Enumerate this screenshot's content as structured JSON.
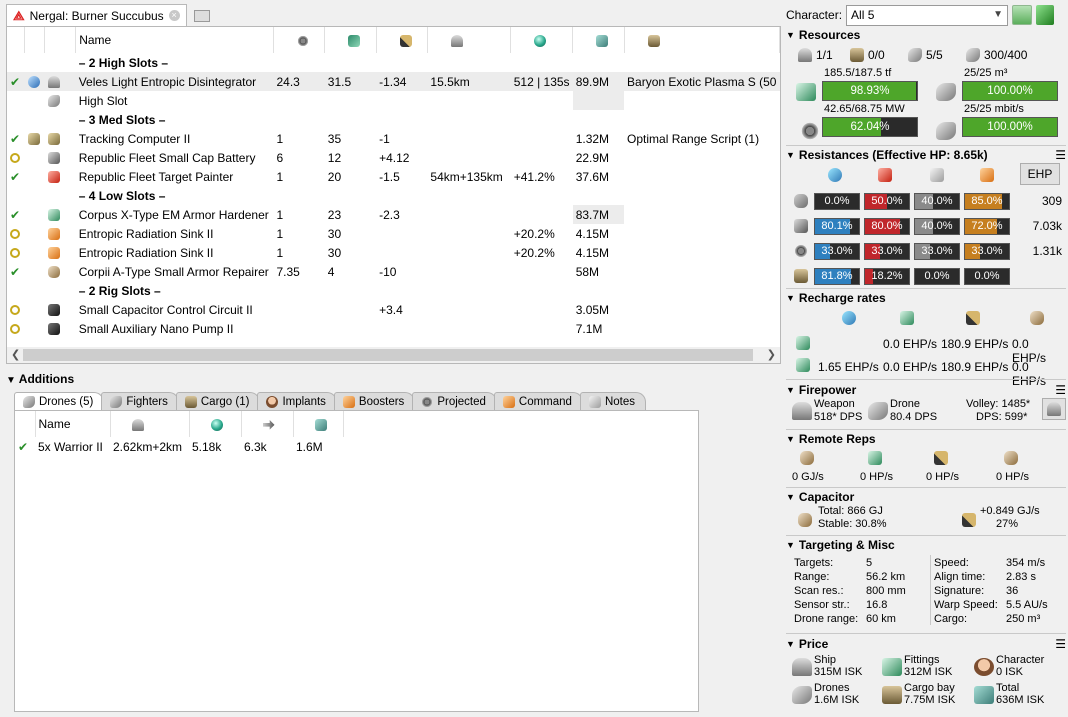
{
  "fit_tab": {
    "title": "Nergal: Burner Succubus"
  },
  "columns": {
    "name": "Name"
  },
  "modules": [
    {
      "kind": "header",
      "name": "– 2 High Slots –"
    },
    {
      "kind": "mod",
      "state": "check",
      "icon2": "c-blue",
      "icon": "c-ship",
      "name": "Veles Light Entropic Disintegrator",
      "c1": "24.3",
      "c2": "31.5",
      "c3": "-1.34",
      "c4": "15.5km",
      "c5": "512 | 135s",
      "c6": "89.9M",
      "c7": "Baryon Exotic Plasma S (50",
      "selected": true
    },
    {
      "kind": "mod",
      "state": "",
      "icon2": "",
      "icon": "c-drone",
      "name": "High Slot",
      "c1": "",
      "c2": "",
      "c3": "",
      "c4": "",
      "c5": "",
      "c6": "",
      "c7": "",
      "hl6": true
    },
    {
      "kind": "header",
      "name": "– 3 Med Slots –"
    },
    {
      "kind": "mod",
      "state": "check",
      "icon2": "c-hull",
      "icon": "c-hull",
      "name": "Tracking Computer II",
      "c1": "1",
      "c2": "35",
      "c3": "-1",
      "c4": "",
      "c5": "",
      "c6": "1.32M",
      "c7": "Optimal Range Script (1)"
    },
    {
      "kind": "mod",
      "state": "ring",
      "icon2": "",
      "icon": "c-armor",
      "name": "Republic Fleet Small Cap Battery",
      "c1": "6",
      "c2": "12",
      "c3": "+4.12",
      "c4": "",
      "c5": "",
      "c6": "22.9M",
      "c7": ""
    },
    {
      "kind": "mod",
      "state": "check",
      "icon2": "",
      "icon": "c-red",
      "name": "Republic Fleet Target Painter",
      "c1": "1",
      "c2": "20",
      "c3": "-1.5",
      "c4": "54km+135km",
      "c5": "+41.2%",
      "c6": "37.6M",
      "c7": ""
    },
    {
      "kind": "header",
      "name": "– 4 Low Slots –"
    },
    {
      "kind": "mod",
      "state": "check",
      "icon2": "",
      "icon": "c-chip",
      "name": "Corpus X-Type EM Armor Hardener",
      "c1": "1",
      "c2": "23",
      "c3": "-2.3",
      "c4": "",
      "c5": "",
      "c6": "83.7M",
      "c7": "",
      "hl6": true
    },
    {
      "kind": "mod",
      "state": "ring",
      "icon2": "",
      "icon": "c-orange",
      "name": "Entropic Radiation Sink II",
      "c1": "1",
      "c2": "30",
      "c3": "",
      "c4": "",
      "c5": "+20.2%",
      "c6": "4.15M",
      "c7": ""
    },
    {
      "kind": "mod",
      "state": "ring",
      "icon2": "",
      "icon": "c-orange",
      "name": "Entropic Radiation Sink II",
      "c1": "1",
      "c2": "30",
      "c3": "",
      "c4": "",
      "c5": "+20.2%",
      "c6": "4.15M",
      "c7": ""
    },
    {
      "kind": "mod",
      "state": "check",
      "icon2": "",
      "icon": "c-cap",
      "name": "Corpii A-Type Small Armor Repairer",
      "c1": "7.35",
      "c2": "4",
      "c3": "-10",
      "c4": "",
      "c5": "",
      "c6": "58M",
      "c7": ""
    },
    {
      "kind": "header",
      "name": "– 2 Rig Slots –"
    },
    {
      "kind": "mod",
      "state": "ring",
      "icon2": "",
      "icon": "c-dark",
      "name": "Small Capacitor Control Circuit II",
      "c1": "",
      "c2": "",
      "c3": "+3.4",
      "c4": "",
      "c5": "",
      "c6": "3.05M",
      "c7": ""
    },
    {
      "kind": "mod",
      "state": "ring",
      "icon2": "",
      "icon": "c-dark",
      "name": "Small Auxiliary Nano Pump II",
      "c1": "",
      "c2": "",
      "c3": "",
      "c4": "",
      "c5": "",
      "c6": "7.1M",
      "c7": ""
    }
  ],
  "additions": {
    "title": "Additions",
    "tabs": [
      {
        "label": "Drones (5)",
        "icon": "c-drone",
        "active": true
      },
      {
        "label": "Fighters",
        "icon": "c-drone"
      },
      {
        "label": "Cargo (1)",
        "icon": "c-cargo"
      },
      {
        "label": "Implants",
        "icon": "c-face"
      },
      {
        "label": "Boosters",
        "icon": "c-orange"
      },
      {
        "label": "Projected",
        "icon": "c-gear"
      },
      {
        "label": "Command",
        "icon": "c-orange"
      },
      {
        "label": "Notes",
        "icon": "c-grey"
      }
    ],
    "drones": [
      {
        "name": "5x Warrior II",
        "range": "2.62km+2km",
        "speed": "5.18k",
        "dps": "6.3k",
        "price": "1.6M"
      }
    ]
  },
  "character": {
    "label": "Character:",
    "value": "All 5"
  },
  "resources": {
    "title": "Resources",
    "counts": [
      {
        "icon": "c-ship",
        "value": "1/1"
      },
      {
        "icon": "c-cargo",
        "value": "0/0"
      },
      {
        "icon": "c-drone",
        "value": "5/5"
      },
      {
        "icon": "c-drone",
        "value": "300/400"
      }
    ],
    "cpu": {
      "text": "185.5/187.5 tf",
      "pct_label": "98.93%",
      "fill": 98.93
    },
    "power": {
      "text": "42.65/68.75 MW",
      "pct_label": "62.04%",
      "fill": 62.04
    },
    "drone_bay": {
      "text": "25/25 m³",
      "pct_label": "100.00%",
      "fill": 100
    },
    "bandwidth": {
      "text": "25/25 mbit/s",
      "pct_label": "100.00%",
      "fill": 100
    }
  },
  "resistances": {
    "title": "Resistances (Effective HP: 8.65k)",
    "ehp_button": "EHP",
    "rows": [
      {
        "icon": "c-struct",
        "values": [
          "0.0%",
          "50.0%",
          "40.0%",
          "85.0%"
        ],
        "fills": [
          0,
          50,
          40,
          85
        ],
        "hp": "309"
      },
      {
        "icon": "c-armor",
        "values": [
          "80.1%",
          "80.0%",
          "40.0%",
          "72.0%"
        ],
        "fills": [
          80.1,
          80,
          40,
          72
        ],
        "hp": "7.03k"
      },
      {
        "icon": "c-gear",
        "values": [
          "33.0%",
          "33.0%",
          "33.0%",
          "33.0%"
        ],
        "fills": [
          33,
          33,
          33,
          33
        ],
        "hp": "1.31k"
      },
      {
        "icon": "c-cargo",
        "values": [
          "81.8%",
          "18.2%",
          "0.0%",
          "0.0%"
        ],
        "fills": [
          81.8,
          18.2,
          0,
          0
        ],
        "hp": ""
      }
    ],
    "colors": [
      "#2e80bf",
      "#c0262b",
      "#8a8a8a",
      "#c67f1f"
    ]
  },
  "recharge": {
    "title": "Recharge rates",
    "row1": [
      "0.0 EHP/s",
      "180.9 EHP/s",
      "0.0 EHP/s"
    ],
    "row2": [
      "1.65 EHP/s",
      "0.0 EHP/s",
      "180.9 EHP/s",
      "0.0 EHP/s"
    ]
  },
  "firepower": {
    "title": "Firepower",
    "weapon_label": "Weapon",
    "weapon_dps": "518* DPS",
    "drone_label": "Drone",
    "drone_dps": "80.4 DPS",
    "volley": "Volley: 1485*",
    "dps": "DPS: 599*"
  },
  "remote_reps": {
    "title": "Remote Reps",
    "values": [
      "0 GJ/s",
      "0 HP/s",
      "0 HP/s",
      "0 HP/s"
    ]
  },
  "capacitor": {
    "title": "Capacitor",
    "total": "Total: 866 GJ",
    "stable": "Stable: 30.8%",
    "rate": "+0.849 GJ/s",
    "pct": "27%"
  },
  "targeting": {
    "title": "Targeting & Misc",
    "left": [
      {
        "k": "Targets:",
        "v": "5"
      },
      {
        "k": "Range:",
        "v": "56.2 km"
      },
      {
        "k": "Scan res.:",
        "v": "800 mm"
      },
      {
        "k": "Sensor str.:",
        "v": "16.8"
      },
      {
        "k": "Drone range:",
        "v": "60 km"
      }
    ],
    "right": [
      {
        "k": "Speed:",
        "v": "354 m/s"
      },
      {
        "k": "Align time:",
        "v": "2.83 s"
      },
      {
        "k": "Signature:",
        "v": "36"
      },
      {
        "k": "Warp Speed:",
        "v": "5.5 AU/s"
      },
      {
        "k": "Cargo:",
        "v": "250 m³"
      }
    ]
  },
  "price": {
    "title": "Price",
    "items": [
      {
        "label": "Ship",
        "value": "315M ISK",
        "icon": "c-ship"
      },
      {
        "label": "Fittings",
        "value": "312M ISK",
        "icon": "c-chip"
      },
      {
        "label": "Character",
        "value": "0 ISK",
        "icon": "c-face"
      },
      {
        "label": "Drones",
        "value": "1.6M ISK",
        "icon": "c-drone"
      },
      {
        "label": "Cargo bay",
        "value": "7.75M ISK",
        "icon": "c-cargo"
      },
      {
        "label": "Total",
        "value": "636M ISK",
        "icon": "c-tools"
      }
    ]
  }
}
